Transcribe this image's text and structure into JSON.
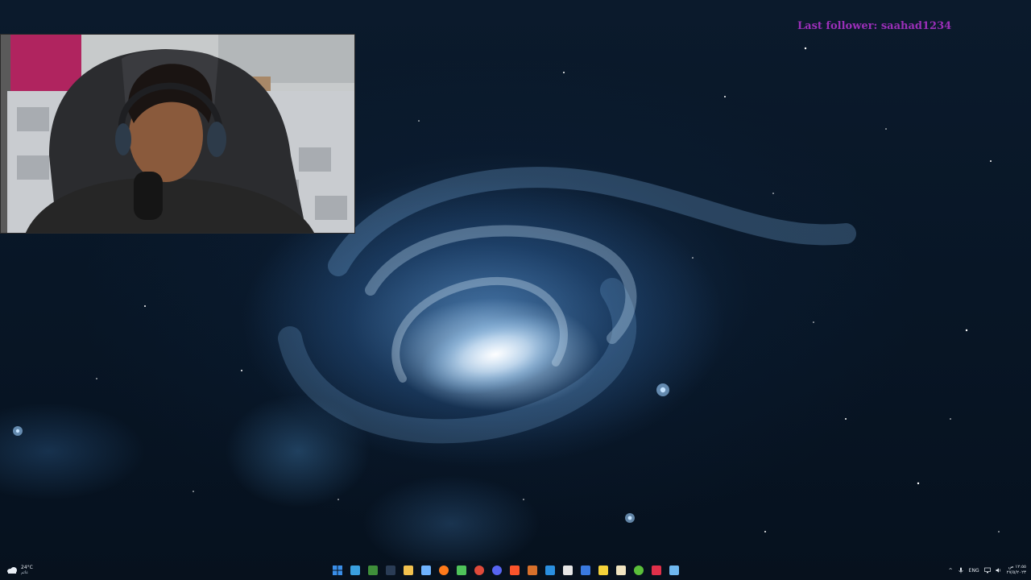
{
  "overlay": {
    "last_follower": "Last follower: saahad1234"
  },
  "taskbar": {
    "weather": {
      "temperature": "24°C",
      "condition": "غائم",
      "icon": "cloud-icon"
    },
    "apps": [
      {
        "name": "start-button",
        "icon": "windows-logo-icon",
        "color": "#3a8ee8",
        "glyph": ""
      },
      {
        "name": "taskbar-app-chat",
        "icon": "chat-icon",
        "color": "#3aa0e0",
        "glyph": ""
      },
      {
        "name": "taskbar-app-minecraft",
        "icon": "minecraft-icon",
        "color": "#3f8f3a",
        "glyph": ""
      },
      {
        "name": "taskbar-app-tool",
        "icon": "tool-icon",
        "color": "#2a3c55",
        "glyph": ""
      },
      {
        "name": "taskbar-app-file-explorer",
        "icon": "folder-icon",
        "color": "#f2c14e",
        "glyph": ""
      },
      {
        "name": "taskbar-app-photos",
        "icon": "photos-icon",
        "color": "#6fb3ff",
        "glyph": ""
      },
      {
        "name": "taskbar-app-firefox",
        "icon": "firefox-icon",
        "color": "#ff7a1a",
        "glyph": ""
      },
      {
        "name": "taskbar-app-store",
        "icon": "store-icon",
        "color": "#4fc35a",
        "glyph": ""
      },
      {
        "name": "taskbar-app-chrome",
        "icon": "chrome-icon",
        "color": "#e04a3a",
        "glyph": ""
      },
      {
        "name": "taskbar-app-discord",
        "icon": "discord-icon",
        "color": "#5865f2",
        "glyph": ""
      },
      {
        "name": "taskbar-app-brave",
        "icon": "brave-icon",
        "color": "#fb542b",
        "glyph": ""
      },
      {
        "name": "taskbar-app-settings-tool",
        "icon": "gear-icon",
        "color": "#d8702b",
        "glyph": ""
      },
      {
        "name": "taskbar-app-vscode",
        "icon": "vscode-icon",
        "color": "#2a8fe0",
        "glyph": ""
      },
      {
        "name": "taskbar-app-calculator",
        "icon": "calculator-icon",
        "color": "#e6e6e6",
        "glyph": ""
      },
      {
        "name": "taskbar-app-shield",
        "icon": "shield-icon",
        "color": "#3a7ae0",
        "glyph": ""
      },
      {
        "name": "taskbar-app-sticky-notes",
        "icon": "note-icon",
        "color": "#f5d33a",
        "glyph": ""
      },
      {
        "name": "taskbar-app-game",
        "icon": "game-icon",
        "color": "#f0e4c0",
        "glyph": ""
      },
      {
        "name": "taskbar-app-launcher",
        "icon": "launcher-icon",
        "color": "#5bbf3a",
        "glyph": ""
      },
      {
        "name": "taskbar-app-media",
        "icon": "media-icon",
        "color": "#e0304a",
        "glyph": ""
      },
      {
        "name": "taskbar-app-window",
        "icon": "window-icon",
        "color": "#6fb8f0",
        "glyph": ""
      }
    ],
    "tray": {
      "language": "ENG",
      "time": "١٢:٥٥ ص",
      "date": "٢٧/٥/٢٠٢٣"
    }
  }
}
